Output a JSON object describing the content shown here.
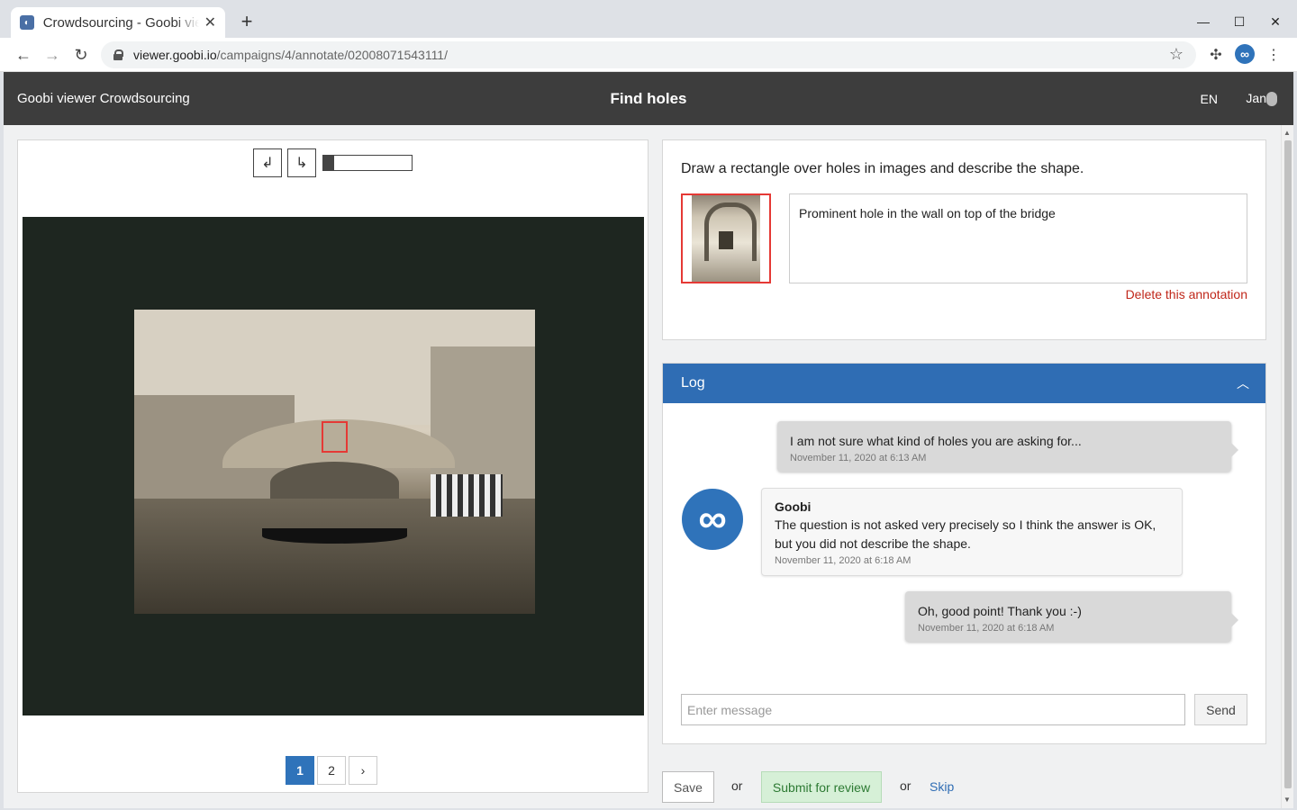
{
  "browser": {
    "tab_title": "Crowdsourcing - Goobi viewer",
    "url_host": "viewer.goobi.io",
    "url_path": "/campaigns/4/annotate/02008071543111/"
  },
  "header": {
    "brand": "Goobi viewer Crowdsourcing",
    "title": "Find holes",
    "language": "EN",
    "user": "Jan"
  },
  "viewer": {
    "pages": [
      "1",
      "2"
    ],
    "active_page": "1",
    "next_label": "›"
  },
  "question": {
    "text": "Draw a rectangle over holes in images and describe the shape.",
    "answer": "Prominent hole in the wall on top of the bridge",
    "delete_label": "Delete this annotation"
  },
  "log": {
    "title": "Log",
    "messages": [
      {
        "author": "",
        "text": "I am not sure what kind of holes you are asking for...",
        "time": "November 11, 2020 at 6:13 AM"
      },
      {
        "author": "Goobi",
        "text": "The question is not asked very precisely so I think the answer is OK, but you did not describe the shape.",
        "time": "November 11, 2020 at 6:18 AM"
      },
      {
        "author": "",
        "text": "Oh, good point! Thank you :-)",
        "time": "November 11, 2020 at 6:18 AM"
      }
    ],
    "input_placeholder": "Enter message",
    "send_label": "Send"
  },
  "actions": {
    "save_label": "Save",
    "or_label": "or",
    "submit_label": "Submit for review",
    "skip_label": "Skip"
  },
  "colors": {
    "header_bg": "#3d3d3d",
    "accent": "#2f6db4",
    "annotation_red": "#e53935",
    "submit_bg": "#d6f0d7"
  }
}
